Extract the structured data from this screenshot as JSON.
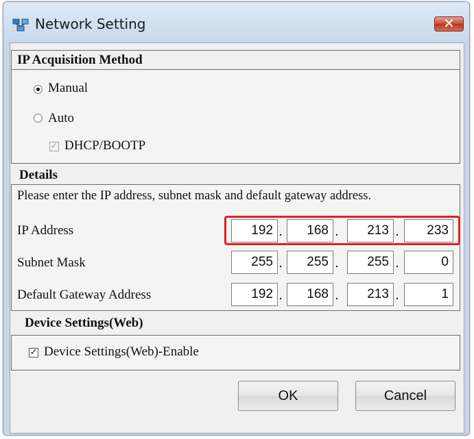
{
  "window": {
    "title": "Network Setting",
    "close_label": "✕",
    "app_icon": "network-settings-icon"
  },
  "ip_acquisition": {
    "header": "IP Acquisition Method",
    "manual_label": "Manual",
    "manual_selected": true,
    "auto_label": "Auto",
    "auto_selected": false,
    "dhcp_label": "DHCP/BOOTP",
    "dhcp_checked": true,
    "dhcp_enabled": false
  },
  "details": {
    "header": "Details",
    "instruction": "Please enter the IP address, subnet mask and default gateway address.",
    "ip_address": {
      "label": "IP Address",
      "octets": [
        "192",
        "168",
        "213",
        "233"
      ]
    },
    "subnet_mask": {
      "label": "Subnet Mask",
      "octets": [
        "255",
        "255",
        "255",
        "0"
      ]
    },
    "default_gateway": {
      "label": "Default Gateway Address",
      "octets": [
        "192",
        "168",
        "213",
        "1"
      ]
    },
    "separator": "."
  },
  "device_settings": {
    "header": "Device Settings(Web)",
    "enable_label": "Device Settings(Web)-Enable",
    "enable_checked": true
  },
  "buttons": {
    "ok_label": "OK",
    "cancel_label": "Cancel"
  },
  "colors": {
    "highlight": "#e02020",
    "close_button": "#c74a33"
  }
}
